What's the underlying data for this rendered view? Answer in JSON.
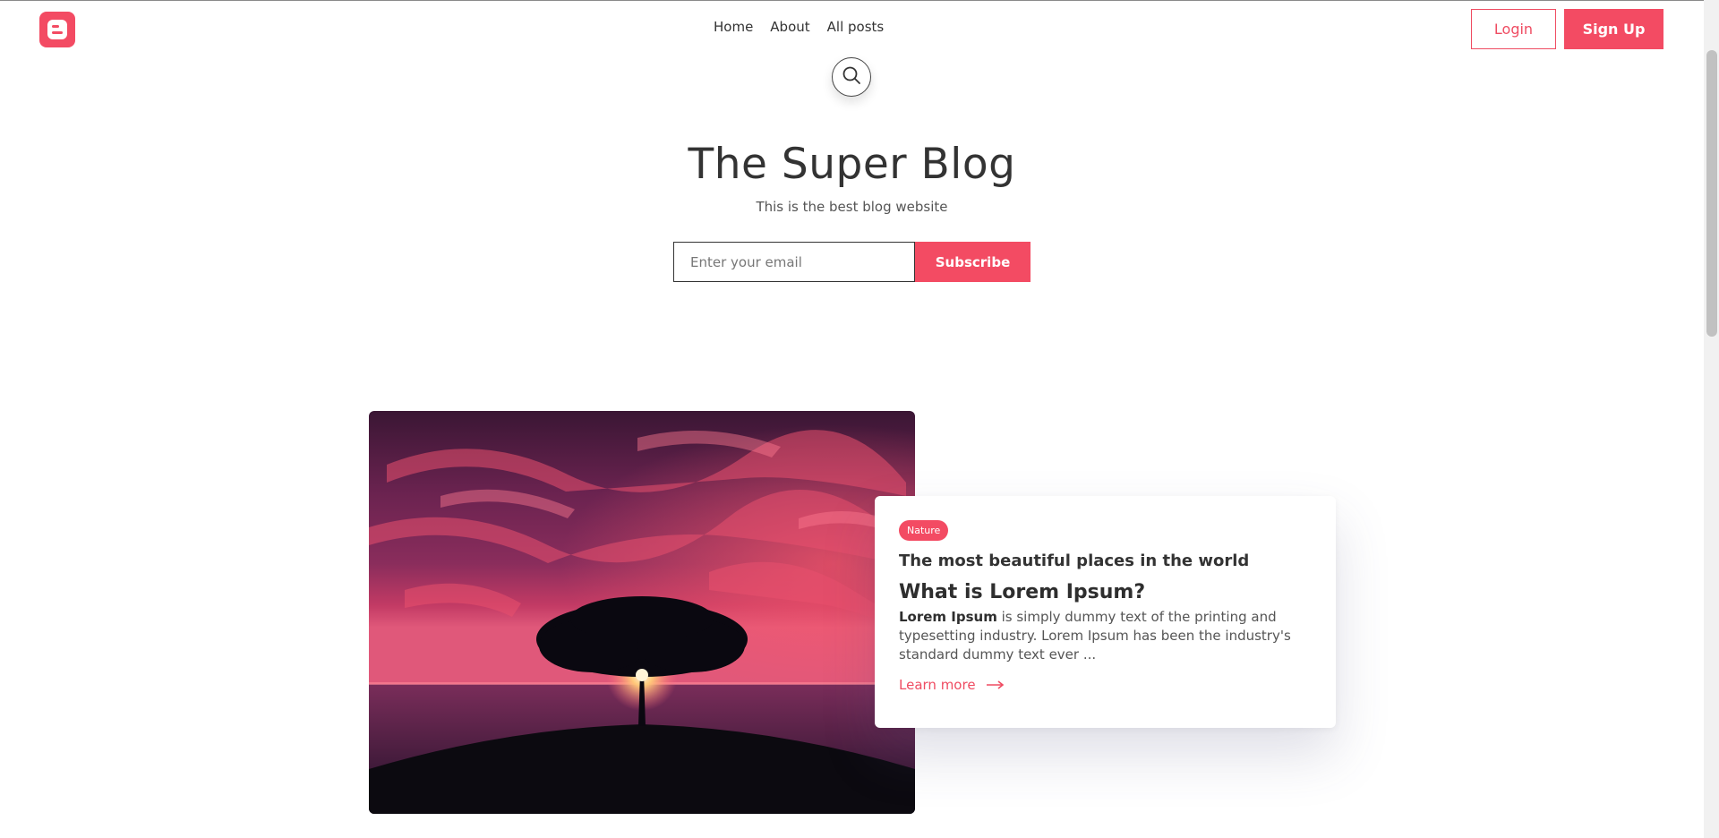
{
  "header": {
    "logo_icon": "blogger-logo-icon",
    "nav": [
      {
        "label": "Home"
      },
      {
        "label": "About"
      },
      {
        "label": "All posts"
      }
    ],
    "login_label": "Login",
    "signup_label": "Sign Up",
    "search_icon": "search-icon"
  },
  "hero": {
    "title": "The Super Blog",
    "subtitle": "This is the best blog website",
    "email_placeholder": "Enter your email",
    "subscribe_label": "Subscribe"
  },
  "post": {
    "image_description": "",
    "tag": "Nature",
    "title": "The most beautiful places in the world",
    "heading": "What is Lorem Ipsum?",
    "excerpt_bold": "Lorem Ipsum",
    "excerpt_rest": " is simply dummy text of the printing and typesetting industry. Lorem Ipsum has been the industry's standard dummy text ever ...",
    "learn_more_label": "Learn more",
    "arrow_icon": "arrow-right-icon"
  },
  "colors": {
    "accent": "#f34b63",
    "text": "#333333"
  }
}
